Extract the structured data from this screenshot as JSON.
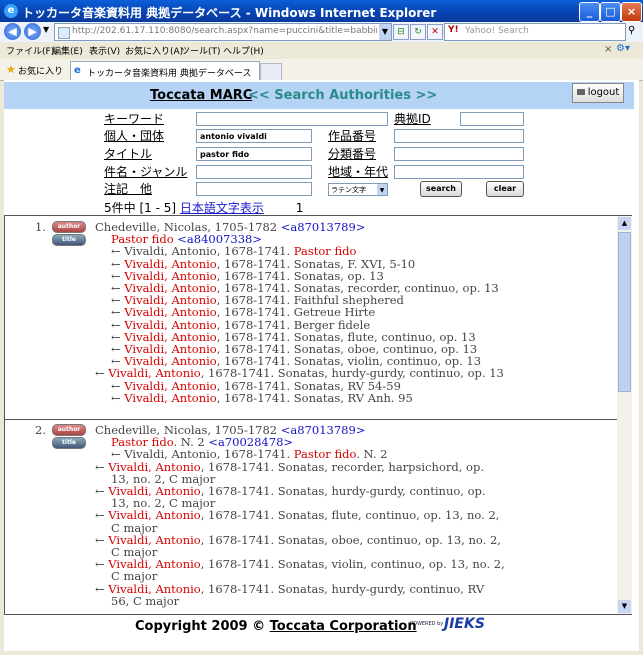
{
  "window": {
    "title": "トッカータ音楽資料用 典拠データベース - Windows Internet Explorer"
  },
  "address_bar": {
    "url": "http://202.61.17.110:8080/search.aspx?name=puccini&title=babbino&genre=&keyw",
    "search_placeholder": "Yahoo! Search"
  },
  "menu": [
    "ファイル(F)",
    "編集(E)",
    "表示(V)",
    "お気に入り(A)",
    "ツール(T)",
    "ヘルプ(H)"
  ],
  "favorites": {
    "label": "お気に入り",
    "tab_title": "トッカータ音楽資料用 典拠データベース"
  },
  "header": {
    "title": "Toccata MARC",
    "subtitle": "<< Search Authorities >>",
    "logout": "logout"
  },
  "form": {
    "keyword_label": "キーワード",
    "authority_id_label": "典拠ID",
    "person_label": "個人・団体",
    "person_value": "antonio vivaldi",
    "work_number_label": "作品番号",
    "title_label": "タイトル",
    "title_value": "pastor fido",
    "class_number_label": "分類番号",
    "subject_label": "件名・ジャンル",
    "region_label": "地域・年代",
    "note_label": "注記　他",
    "script_select": "ラテン文字",
    "search_button": "search",
    "clear_button": "clear"
  },
  "results_summary": {
    "count_text": "5件中 [1 - 5]",
    "japanese_link": "日本語文字表示",
    "page": "1"
  },
  "icons": {
    "author_icon": "author",
    "title_icon": "title"
  },
  "results": [
    {
      "num": "1.",
      "heading": "Chedeville, Nicolas, 1705-1782",
      "heading_id": "<a87013789>",
      "title": "Pastor fido",
      "title_suffix": "",
      "title_id": "<a84007338>",
      "refs": [
        {
          "arrow": "←",
          "name": "Vivaldi, Antonio",
          "rest": ", 1678-1741. ",
          "title_red": "Pastor fido",
          "after": ""
        },
        {
          "arrow": "←",
          "name": "Vivaldi, Antonio",
          "rest": ", 1678-1741. Sonatas, F. XVI, 5-10"
        },
        {
          "arrow": "←",
          "name": "Vivaldi, Antonio",
          "rest": ", 1678-1741. Sonatas, op. 13"
        },
        {
          "arrow": "←",
          "name": "Vivaldi, Antonio",
          "rest": ", 1678-1741. Sonatas, recorder, continuo, op. 13"
        },
        {
          "arrow": "←",
          "name": "Vivaldi, Antonio",
          "rest": ", 1678-1741. Faithful shephered"
        },
        {
          "arrow": "←",
          "name": "Vivaldi, Antonio",
          "rest": ", 1678-1741. Getreue Hirte"
        },
        {
          "arrow": "←",
          "name": "Vivaldi, Antonio",
          "rest": ", 1678-1741. Berger fidele"
        },
        {
          "arrow": "←",
          "name": "Vivaldi, Antonio",
          "rest": ", 1678-1741. Sonatas, flute, continuo, op. 13"
        },
        {
          "arrow": "←",
          "name": "Vivaldi, Antonio",
          "rest": ", 1678-1741. Sonatas, oboe, continuo, op. 13"
        },
        {
          "arrow": "←",
          "name": "Vivaldi, Antonio",
          "rest": ", 1678-1741. Sonatas, violin, continuo, op. 13"
        },
        {
          "arrow": "←",
          "name": "Vivaldi, Antonio",
          "rest": ", 1678-1741. Sonatas, hurdy-gurdy, continuo, op. 13"
        },
        {
          "arrow": "←",
          "name": "Vivaldi, Antonio",
          "rest": ", 1678-1741. Sonatas, RV 54-59"
        },
        {
          "arrow": "←",
          "name": "Vivaldi, Antonio",
          "rest": ", 1678-1741. Sonatas, RV Anh. 95"
        }
      ]
    },
    {
      "num": "2.",
      "heading": "Chedeville, Nicolas, 1705-1782",
      "heading_id": "<a87013789>",
      "title": "Pastor fido",
      "title_suffix": ". N. 2",
      "title_id": "<a70028478>",
      "refs": [
        {
          "arrow": "←",
          "name": "Vivaldi, Antonio",
          "rest": ", 1678-1741. ",
          "title_red": "Pastor fido",
          "after": ". N. 2"
        },
        {
          "arrow": "←",
          "name": "Vivaldi, Antonio",
          "rest": ", 1678-1741. Sonatas, recorder, harpsichord, op. 13, no. 2, C major"
        },
        {
          "arrow": "←",
          "name": "Vivaldi, Antonio",
          "rest": ", 1678-1741. Sonatas, hurdy-gurdy, continuo, op. 13, no. 2, C major"
        },
        {
          "arrow": "←",
          "name": "Vivaldi, Antonio",
          "rest": ", 1678-1741. Sonatas, flute, continuo, op. 13, no. 2, C major"
        },
        {
          "arrow": "←",
          "name": "Vivaldi, Antonio",
          "rest": ", 1678-1741. Sonatas, oboe, continuo, op. 13, no. 2, C major"
        },
        {
          "arrow": "←",
          "name": "Vivaldi, Antonio",
          "rest": ", 1678-1741. Sonatas, violin, continuo, op. 13, no. 2, C major"
        },
        {
          "arrow": "←",
          "name": "Vivaldi, Antonio",
          "rest": ", 1678-1741. Sonatas, hurdy-gurdy, continuo, RV 56, C major"
        }
      ]
    }
  ],
  "footer": {
    "copyright_prefix": "Copyright 2009 © ",
    "company": "Toccata Corporation",
    "powered_by": "POWERED by",
    "powered_logo": "JIEKS"
  }
}
